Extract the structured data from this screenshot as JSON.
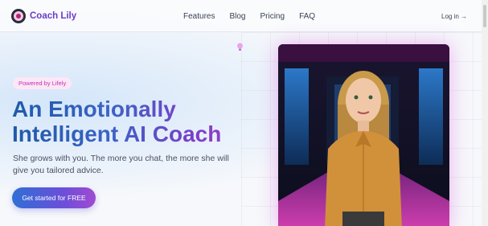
{
  "brand": {
    "name": "Coach Lily"
  },
  "nav": {
    "links": [
      "Features",
      "Blog",
      "Pricing",
      "FAQ"
    ],
    "login": "Log in →"
  },
  "hero": {
    "badge": "Powered by Lifely",
    "headline_line1": "An Emotionally",
    "headline_line2": "Intelligent AI Coach",
    "subtitle": "She grows with you. The more you chat, the more she will give you tailored advice.",
    "cta": "Get started for FREE"
  },
  "icons": {
    "logo": "logo-icon",
    "bulb": "lightbulb-icon"
  },
  "colors": {
    "brand_purple": "#6a3cc9",
    "cta_start": "#2f6fd6",
    "cta_end": "#a04ad2",
    "badge_text": "#c42fb3"
  }
}
